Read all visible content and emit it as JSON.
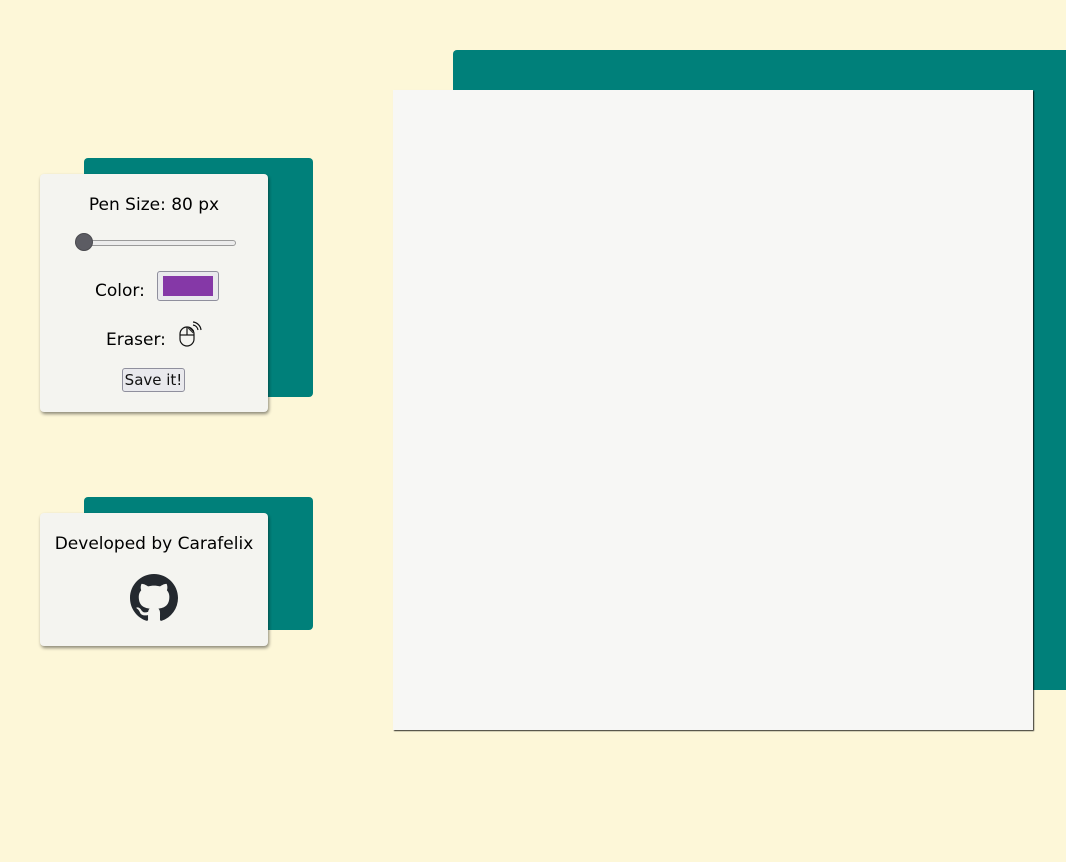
{
  "controls": {
    "pen_size_label": "Pen Size: 80 px",
    "pen_size_value": 80,
    "pen_size_slider_fraction": 0.0,
    "color_label": "Color:",
    "color_value": "#8538a7",
    "eraser_label": "Eraser:",
    "eraser_icon": "mouse-icon",
    "save_label": "Save it!"
  },
  "credit": {
    "text": "Developed by Carafelix",
    "icon": "github-icon"
  },
  "colors": {
    "background": "#fdf7d8",
    "accent_teal": "#00807a",
    "card": "#f4f4f0",
    "canvas": "#f7f7f5"
  }
}
